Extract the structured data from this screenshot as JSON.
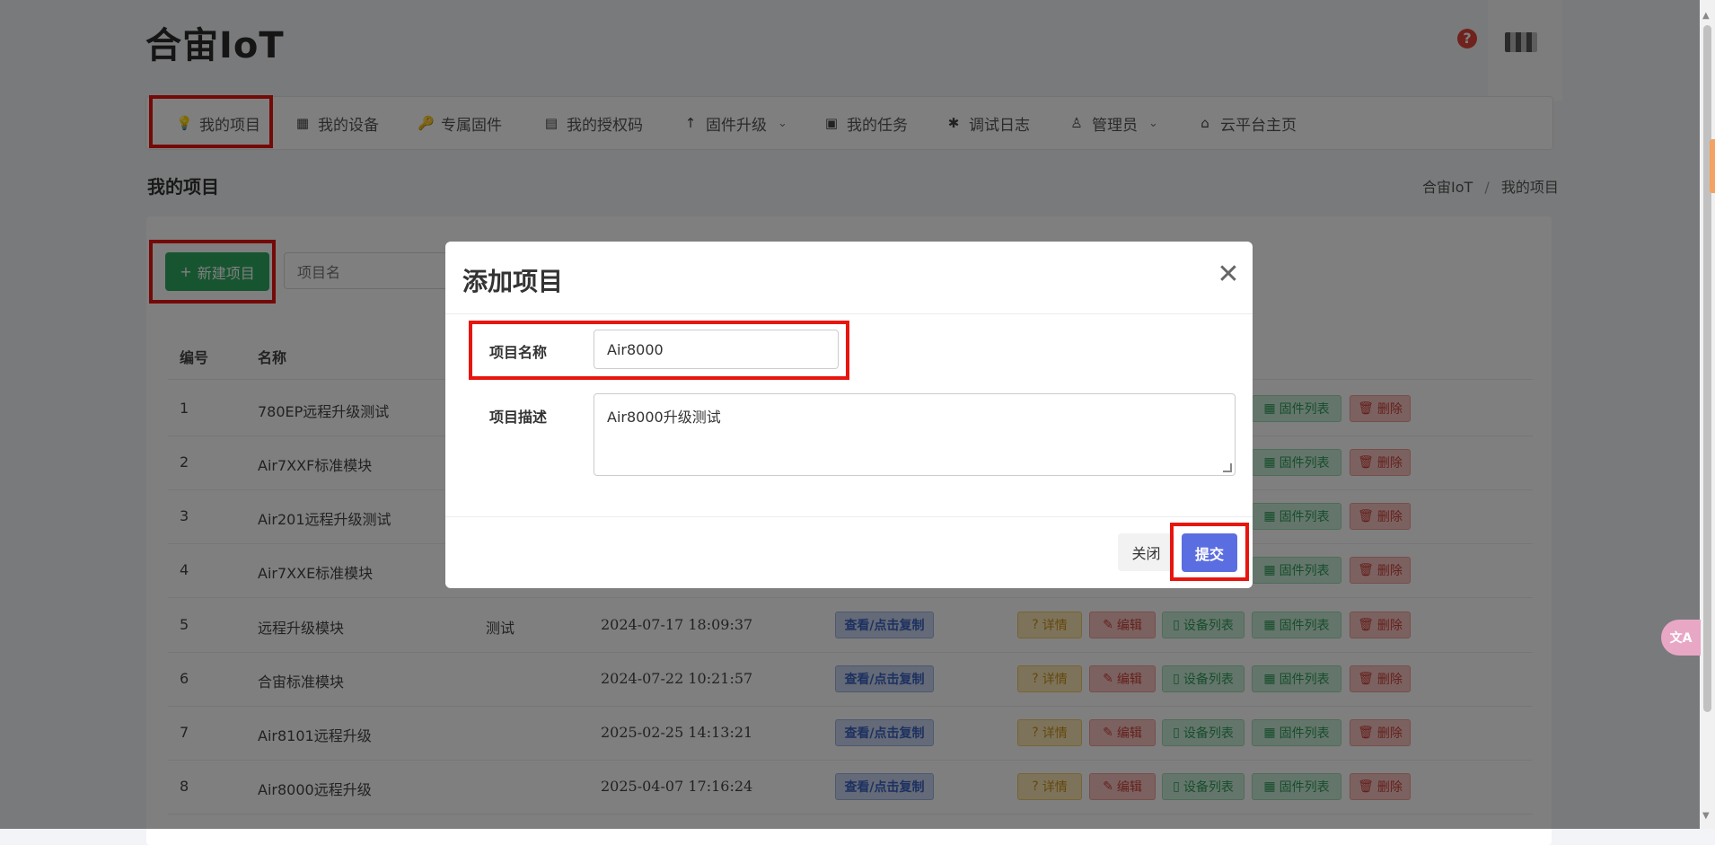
{
  "app": {
    "brand": "合宙IoT"
  },
  "nav": {
    "items": [
      {
        "label": "我的项目",
        "icon": "bulb-icon",
        "glyph": "💡"
      },
      {
        "label": "我的设备",
        "icon": "chip-icon",
        "glyph": "▦"
      },
      {
        "label": "专属固件",
        "icon": "key-icon",
        "glyph": "🔑"
      },
      {
        "label": "我的授权码",
        "icon": "barcode-icon",
        "glyph": "▤"
      },
      {
        "label": "固件升级",
        "icon": "arrow-up-icon",
        "glyph": "↑",
        "caret": "⌄"
      },
      {
        "label": "我的任务",
        "icon": "calendar-icon",
        "glyph": "▣"
      },
      {
        "label": "调试日志",
        "icon": "bug-icon",
        "glyph": "✱"
      },
      {
        "label": "管理员",
        "icon": "user-icon",
        "glyph": "♙",
        "caret": "⌄"
      },
      {
        "label": "云平台主页",
        "icon": "home-icon",
        "glyph": "⌂"
      }
    ]
  },
  "header": {
    "help_glyph": "?"
  },
  "page": {
    "title": "我的项目",
    "breadcrumb": {
      "home": "合宙IoT",
      "sep": "/",
      "current": "我的项目"
    }
  },
  "toolbar": {
    "new_label": "新建项目",
    "new_glyph": "+",
    "search_placeholder": "项目名"
  },
  "table": {
    "headers": {
      "id": "编号",
      "name": "名称"
    },
    "copy_label": "查看/点击复制",
    "actions": {
      "detail": "详情",
      "edit": "编辑",
      "devices": "设备列表",
      "firmware": "固件列表",
      "delete": "删除",
      "detail_glyph": "?",
      "edit_glyph": "✎",
      "devices_glyph": "▯",
      "firmware_glyph": "▦",
      "delete_glyph": "🗑"
    },
    "rows": [
      {
        "id": "1",
        "name": "780EP远程升级测试",
        "desc": "",
        "time": ""
      },
      {
        "id": "2",
        "name": "Air7XXF标准模块",
        "desc": "",
        "time": ""
      },
      {
        "id": "3",
        "name": "Air201远程升级测试",
        "desc": "",
        "time": ""
      },
      {
        "id": "4",
        "name": "Air7XXE标准模块",
        "desc": "",
        "time": ""
      },
      {
        "id": "5",
        "name": "远程升级模块",
        "desc": "测试",
        "time": "2024-07-17 18:09:37"
      },
      {
        "id": "6",
        "name": "合宙标准模块",
        "desc": "",
        "time": "2024-07-22 10:21:57"
      },
      {
        "id": "7",
        "name": "Air8101远程升级",
        "desc": "",
        "time": "2025-02-25 14:13:21"
      },
      {
        "id": "8",
        "name": "Air8000远程升级",
        "desc": "",
        "time": "2025-04-07 17:16:24"
      }
    ]
  },
  "modal": {
    "title": "添加项目",
    "close_glyph": "✕",
    "name_label": "项目名称",
    "name_value": "Air8000",
    "desc_label": "项目描述",
    "desc_value": "Air8000升级测试",
    "btn_close": "关闭",
    "btn_submit": "提交"
  },
  "floating": {
    "translate_glyph": "文A"
  },
  "colors": {
    "highlight": "#e8150f",
    "primary": "#5b6ee1",
    "success": "#2eab62"
  }
}
